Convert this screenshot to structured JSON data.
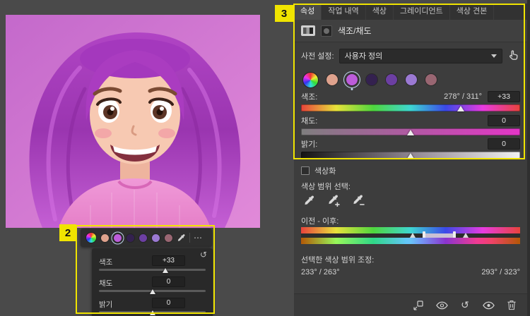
{
  "annotations": {
    "label_2": "2",
    "label_3": "3",
    "highlight_color": "#f0e400"
  },
  "icons": {
    "reset": "↺",
    "menu_dots": "⋯"
  },
  "panel": {
    "tabs": [
      "속성",
      "작업 내역",
      "색상",
      "그레이디언트",
      "색상 견본"
    ],
    "active_tab": "속성",
    "title": "색조/채도",
    "preset": {
      "label": "사전 설정:",
      "value": "사용자 정의"
    },
    "swatch_colors": [
      "#dfa28d",
      "#bc5cda",
      "#34214f",
      "#6c3fa2",
      "#9b79d3",
      "#996672"
    ],
    "selected_swatch_index": 1,
    "hue": {
      "label": "색조:",
      "range": "278° / 311°",
      "value": "+33",
      "position_pct": 73
    },
    "saturation": {
      "label": "채도:",
      "value": "0",
      "position_pct": 50
    },
    "lightness": {
      "label": "밝기:",
      "value": "0",
      "position_pct": 50
    },
    "colorize": {
      "label": "색상화",
      "checked": false
    },
    "color_range_label": "색상 범위 선택:",
    "before_after_label": "이전 - 이후:",
    "adjust_range_label": "선택한 색상 범위 조정:",
    "range_values": {
      "left": "233° / 263°",
      "right": "293° / 323°"
    },
    "range_markers": {
      "bar_left_pct": 56,
      "bar_right_pct": 70,
      "tri_left_pct": 51,
      "tri_right_pct": 75
    }
  },
  "mini_panel": {
    "rows": [
      {
        "label": "색조",
        "value": "+33",
        "position_pct": 62
      },
      {
        "label": "채도",
        "value": "0",
        "position_pct": 50
      },
      {
        "label": "밝기",
        "value": "0",
        "position_pct": 50
      }
    ]
  }
}
